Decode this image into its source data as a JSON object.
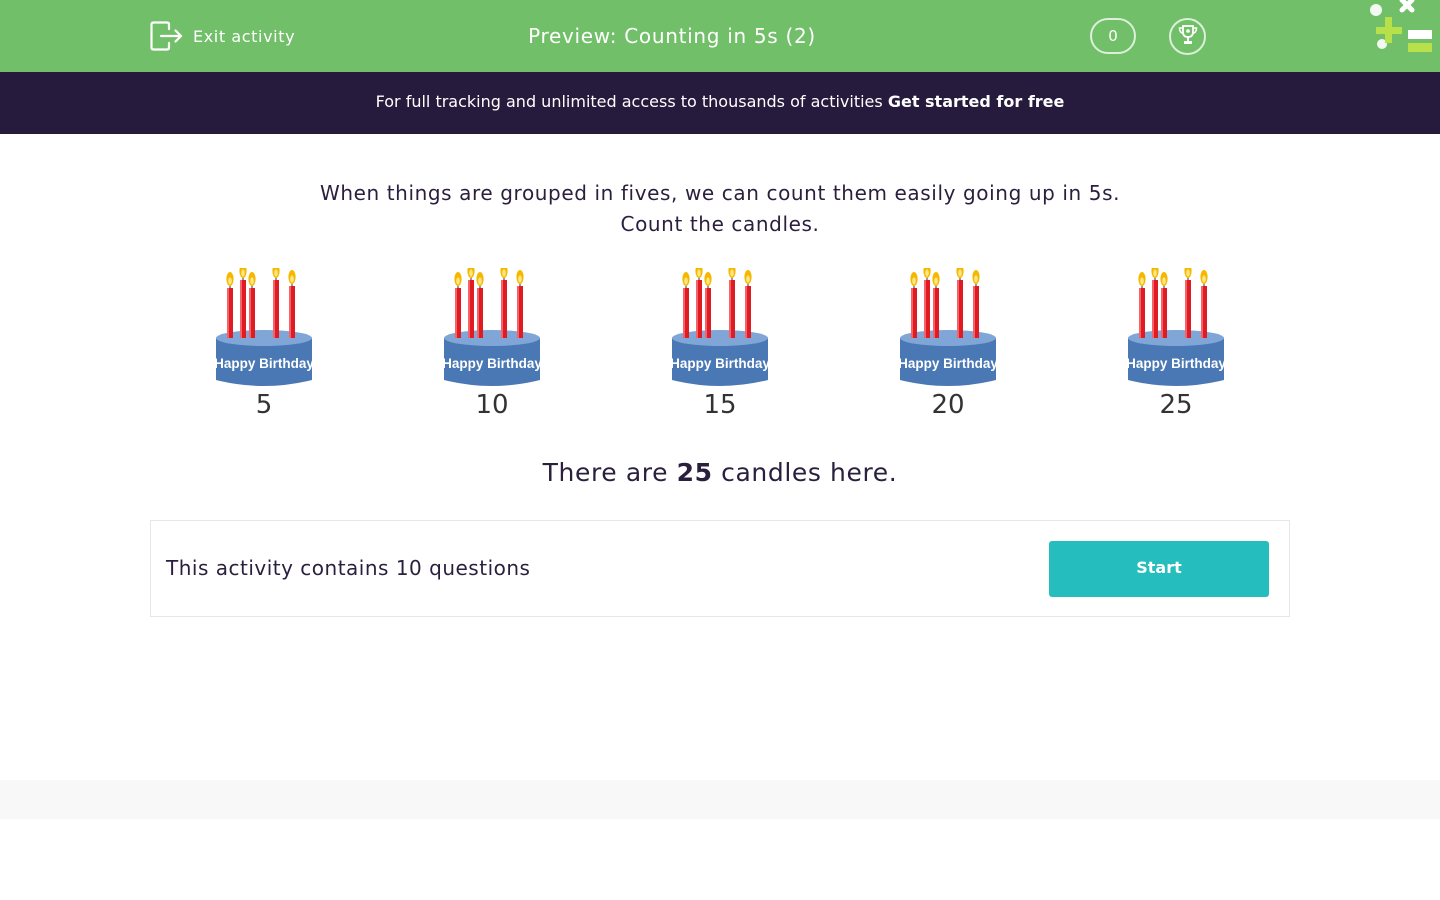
{
  "header": {
    "exit_label": "Exit activity",
    "title": "Preview: Counting in 5s (2)",
    "score": "0",
    "colors": {
      "background": "#72bf6a",
      "logo_green": "#b8e04a"
    }
  },
  "banner": {
    "text": "For full tracking and unlimited access to thousands of activities ",
    "link": "Get started for free",
    "color": "#261b3c"
  },
  "question": {
    "line1": "When things are grouped in fives, we can count them easily going up in 5s.",
    "line2": "Count the candles.",
    "cakes": [
      {
        "label": "Happy Birthday",
        "count": "5"
      },
      {
        "label": "Happy Birthday",
        "count": "10"
      },
      {
        "label": "Happy Birthday",
        "count": "15"
      },
      {
        "label": "Happy Birthday",
        "count": "20"
      },
      {
        "label": "Happy Birthday",
        "count": "25"
      }
    ],
    "answer_prefix": "There are ",
    "answer_value": "25",
    "answer_suffix": " candles here."
  },
  "panel": {
    "text": "This activity contains 10 questions",
    "start_label": "Start",
    "start_color": "#25bdbd"
  },
  "icons": [
    "exit-icon",
    "trophy-icon",
    "logo-icon",
    "candle-icon"
  ]
}
